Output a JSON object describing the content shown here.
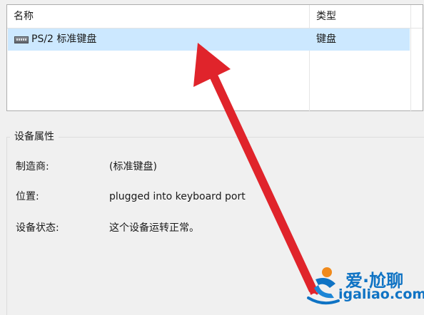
{
  "device_list": {
    "columns": {
      "name": "名称",
      "type": "类型"
    },
    "rows": [
      {
        "icon": "keyboard-icon",
        "name": "PS/2 标准键盘",
        "type": "键盘",
        "selected": true
      }
    ]
  },
  "properties": {
    "title": "设备属性",
    "manufacturer_label": "制造商:",
    "manufacturer_value": "(标准键盘)",
    "location_label": "位置:",
    "location_value": "plugged into keyboard port",
    "status_label": "设备状态:",
    "status_value": "这个设备运转正常。"
  },
  "watermark": {
    "name": "爱·尬聊",
    "domain": "igaliao.com"
  },
  "colors": {
    "selection": "#cce8ff",
    "arrow": "#e0242b",
    "watermark": "#0f73c4"
  }
}
